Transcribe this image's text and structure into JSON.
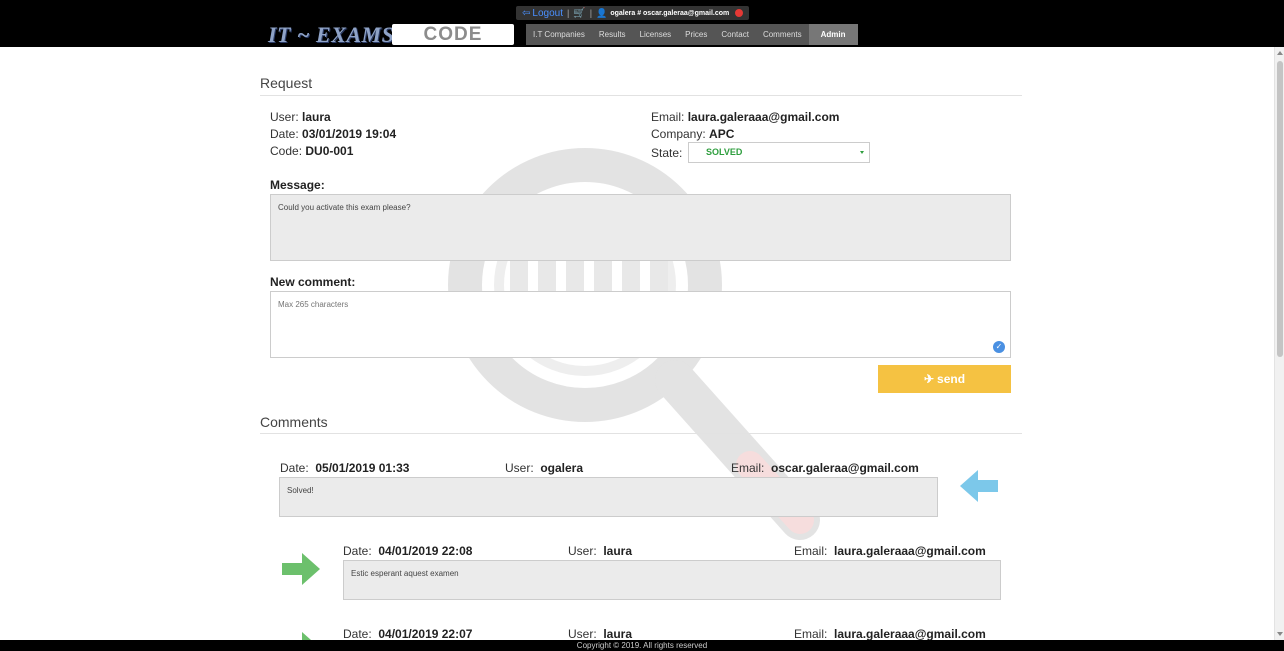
{
  "header": {
    "logout_label": "Logout",
    "user_label": "ogalera # oscar.galeraa@gmail.com",
    "logo_text": "IT ~ EXAMS",
    "code_label": "CODE",
    "nav": [
      {
        "label": "I.T Companies"
      },
      {
        "label": "Results"
      },
      {
        "label": "Licenses"
      },
      {
        "label": "Prices"
      },
      {
        "label": "Contact"
      },
      {
        "label": "Comments"
      },
      {
        "label": "Admin"
      }
    ]
  },
  "request": {
    "title": "Request",
    "user_label": "User:",
    "user": "laura",
    "date_label": "Date:",
    "date": "03/01/2019 19:04",
    "code_label": "Code:",
    "code": "DU0-001",
    "email_label": "Email:",
    "email": "laura.galeraaa@gmail.com",
    "company_label": "Company:",
    "company": "APC",
    "state_label": "State:",
    "state": "SOLVED",
    "message_label": "Message:",
    "message": "Could you activate this exam please?",
    "new_comment_label": "New comment:",
    "new_comment_placeholder": "Max 265 characters",
    "send_label": "send"
  },
  "comments": {
    "title": "Comments",
    "date_label": "Date:",
    "user_label": "User:",
    "email_label": "Email:",
    "items": [
      {
        "date": "05/01/2019 01:33",
        "user": "ogalera",
        "email": "oscar.galeraa@gmail.com",
        "text": "Solved!"
      },
      {
        "date": "04/01/2019 22:08",
        "user": "laura",
        "email": "laura.galeraaa@gmail.com",
        "text": "Estic esperant aquest examen"
      },
      {
        "date": "04/01/2019 22:07",
        "user": "laura",
        "email": "laura.galeraaa@gmail.com",
        "text": ""
      }
    ]
  },
  "footer": {
    "copyright": "Copyright © 2019. All rights reserved"
  },
  "colors": {
    "accent_send": "#f5c242",
    "state_green": "#2e9e3e",
    "arrow_blue": "#7cc8ea",
    "arrow_green": "#6cc06c"
  }
}
